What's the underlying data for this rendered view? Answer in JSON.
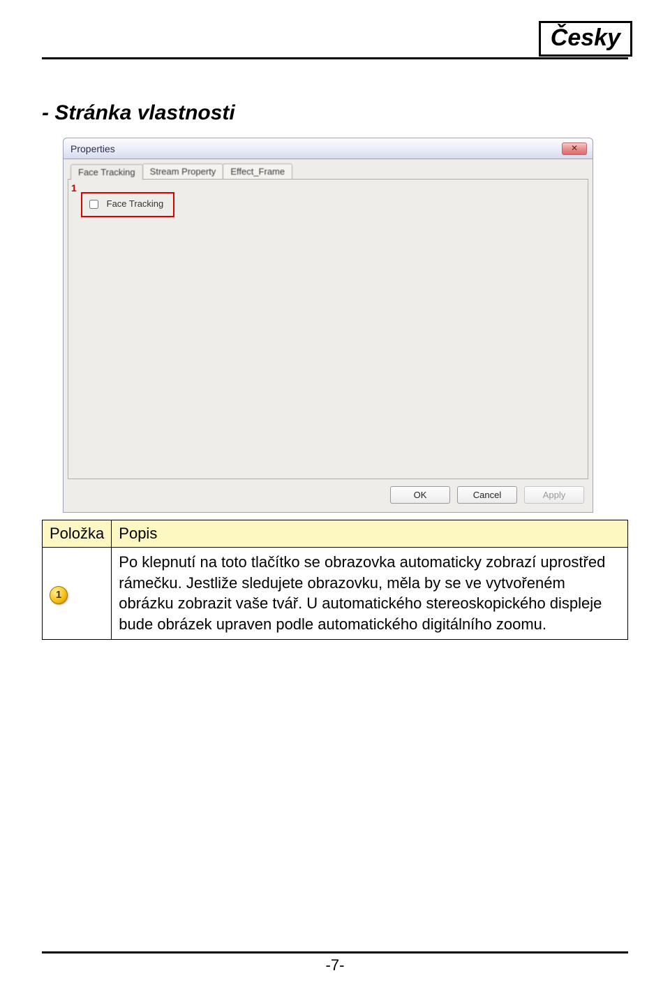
{
  "language_box": "Česky",
  "section_title": "- Stránka vlastnosti",
  "dialog": {
    "title": "Properties",
    "close": "✕",
    "tabs": [
      "Face Tracking",
      "Stream Property",
      "Effect_Frame"
    ],
    "active_tab_index": 0,
    "callout": "1",
    "checkbox_label": "Face Tracking",
    "buttons": {
      "ok": "OK",
      "cancel": "Cancel",
      "apply": "Apply"
    }
  },
  "table": {
    "headers": [
      "Položka",
      "Popis"
    ],
    "rows": [
      {
        "icon_number": "1",
        "text": "Po klepnutí na toto tlačítko se obrazovka automaticky zobrazí uprostřed rámečku. Jestliže sledujete obrazovku, měla by se ve vytvořeném obrázku zobrazit vaše tvář. U automatického stereoskopického displeje bude obrázek upraven podle automatického digitálního zoomu."
      }
    ]
  },
  "page_number": "-7-"
}
